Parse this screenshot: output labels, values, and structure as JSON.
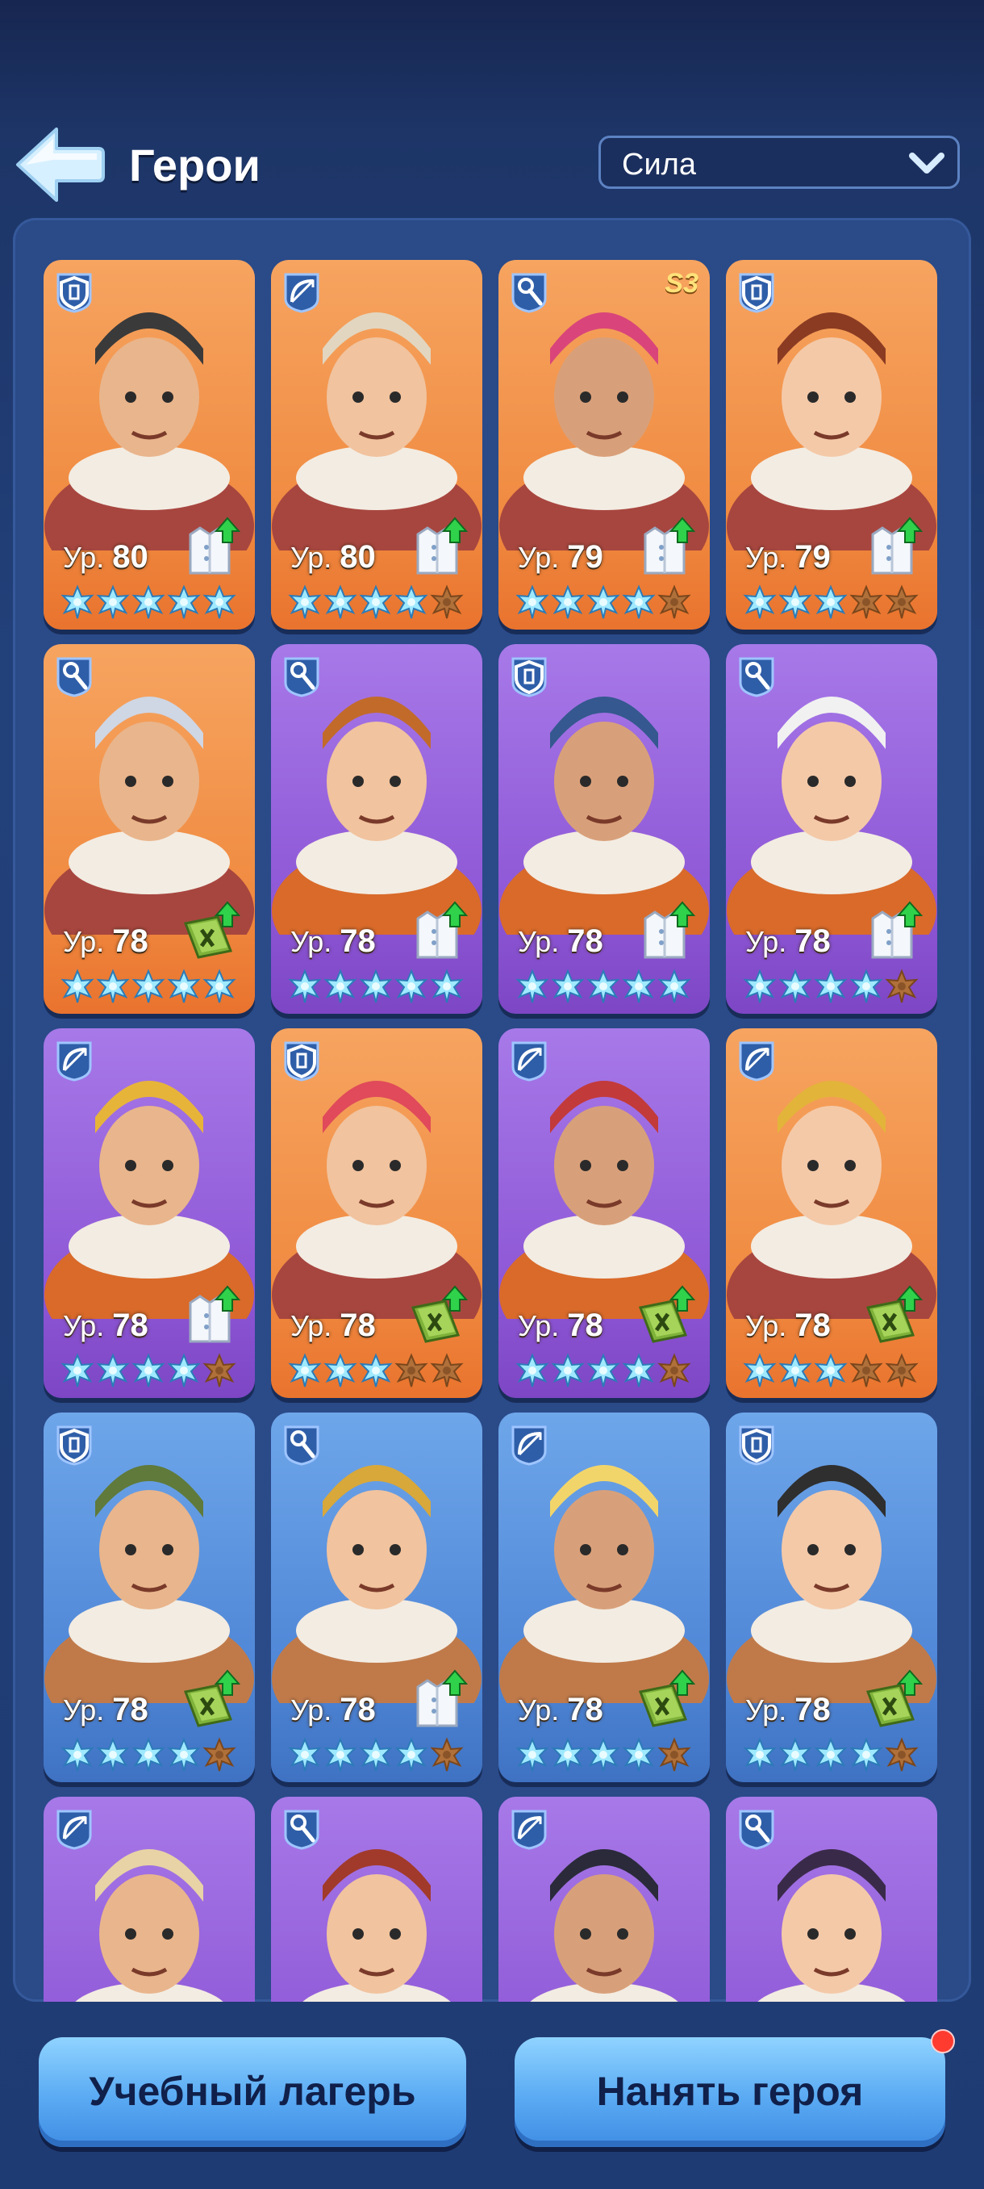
{
  "header": {
    "title": "Герои",
    "back_icon": "back-arrow-icon",
    "sort": {
      "selected": "Сила",
      "icon": "chevron-down-icon"
    }
  },
  "level_prefix": "Ур.",
  "heroes": [
    {
      "level": "80",
      "class": "shield",
      "bg": "orange",
      "stars": 5,
      "upgrade": "coat",
      "season": ""
    },
    {
      "level": "80",
      "class": "bow",
      "bg": "orange",
      "stars": 4,
      "upgrade": "coat",
      "season": ""
    },
    {
      "level": "79",
      "class": "wand",
      "bg": "orange",
      "stars": 4,
      "upgrade": "coat",
      "season": "S3"
    },
    {
      "level": "79",
      "class": "shield",
      "bg": "orange",
      "stars": 3,
      "upgrade": "coat",
      "season": ""
    },
    {
      "level": "78",
      "class": "wand",
      "bg": "orange",
      "stars": 5,
      "upgrade": "manual",
      "season": ""
    },
    {
      "level": "78",
      "class": "wand",
      "bg": "purple",
      "stars": 5,
      "upgrade": "coat",
      "season": ""
    },
    {
      "level": "78",
      "class": "shield",
      "bg": "purple",
      "stars": 5,
      "upgrade": "coat",
      "season": ""
    },
    {
      "level": "78",
      "class": "wand",
      "bg": "purple",
      "stars": 4,
      "upgrade": "coat",
      "season": ""
    },
    {
      "level": "78",
      "class": "bow",
      "bg": "purple",
      "stars": 4,
      "upgrade": "coat",
      "season": ""
    },
    {
      "level": "78",
      "class": "shield",
      "bg": "orange",
      "stars": 3,
      "upgrade": "manual",
      "season": ""
    },
    {
      "level": "78",
      "class": "bow",
      "bg": "purple",
      "stars": 4,
      "upgrade": "manual",
      "season": ""
    },
    {
      "level": "78",
      "class": "bow",
      "bg": "orange",
      "stars": 3,
      "upgrade": "manual",
      "season": ""
    },
    {
      "level": "78",
      "class": "shield",
      "bg": "blue",
      "stars": 4,
      "upgrade": "manual",
      "season": ""
    },
    {
      "level": "78",
      "class": "wand",
      "bg": "blue",
      "stars": 4,
      "upgrade": "coat",
      "season": ""
    },
    {
      "level": "78",
      "class": "bow",
      "bg": "blue",
      "stars": 4,
      "upgrade": "manual",
      "season": ""
    },
    {
      "level": "78",
      "class": "shield",
      "bg": "blue",
      "stars": 4,
      "upgrade": "manual",
      "season": ""
    },
    {
      "level": "",
      "class": "bow",
      "bg": "purple",
      "stars": 0,
      "upgrade": "",
      "season": ""
    },
    {
      "level": "",
      "class": "wand",
      "bg": "purple",
      "stars": 0,
      "upgrade": "",
      "season": ""
    },
    {
      "level": "",
      "class": "bow",
      "bg": "purple",
      "stars": 0,
      "upgrade": "",
      "season": ""
    },
    {
      "level": "",
      "class": "wand",
      "bg": "purple",
      "stars": 0,
      "upgrade": "",
      "season": ""
    }
  ],
  "footer": {
    "training_camp": "Учебный лагерь",
    "hire_hero": "Нанять героя",
    "hire_notification": true
  },
  "colors": {
    "star_active": "#9fe9ff",
    "star_inactive": "#b0703a",
    "upgrade_arrow": "#2fd24a",
    "button_blue": "#5aaaf3"
  }
}
